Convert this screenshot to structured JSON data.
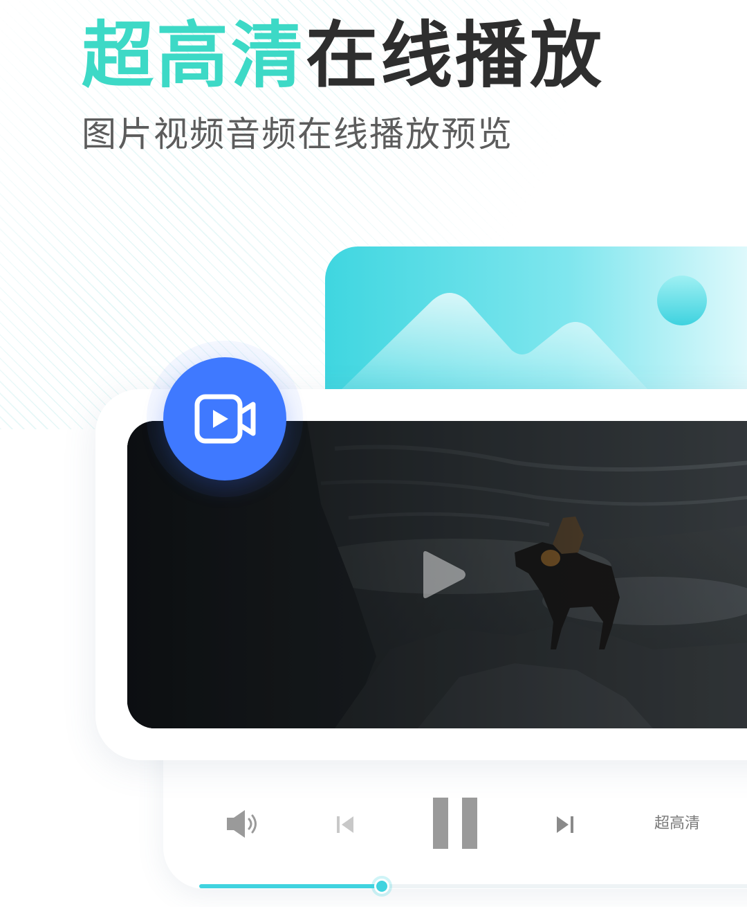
{
  "header": {
    "headline_accent": "超高清",
    "headline_rest": "在线播放",
    "subtitle": "图片视频音频在线播放预览"
  },
  "icons": {
    "camera_badge": "video-camera-icon",
    "image_card": "landscape-image-icon",
    "play": "play-icon",
    "volume": "speaker-icon",
    "previous": "skip-previous-icon",
    "pause": "pause-icon",
    "next": "skip-next-icon"
  },
  "player": {
    "quality_label": "超高清",
    "progress": 0.33
  },
  "colors": {
    "accent_teal": "#3dd9c6",
    "headline_dark": "#2e2e2e",
    "badge_blue": "#3f79ff",
    "progress_cyan": "#40d3df",
    "control_gray": "#9a9a9a"
  }
}
